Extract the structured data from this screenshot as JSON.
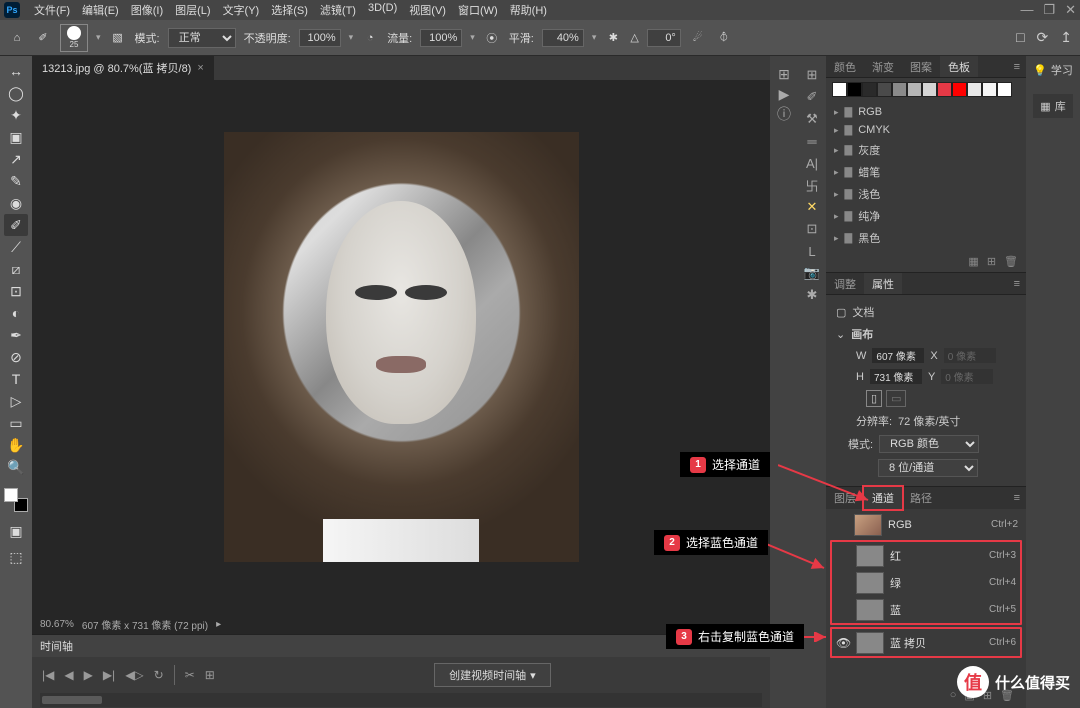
{
  "menu": {
    "items": [
      "文件(F)",
      "编辑(E)",
      "图像(I)",
      "图层(L)",
      "文字(Y)",
      "选择(S)",
      "滤镜(T)",
      "3D(D)",
      "视图(V)",
      "窗口(W)",
      "帮助(H)"
    ]
  },
  "win": {
    "min": "—",
    "restore": "❐",
    "close": "✕"
  },
  "options": {
    "home": "⌂",
    "brushSize": "25",
    "swatchTool": "▧",
    "modeLabel": "模式:",
    "mode": "正常",
    "opacityLabel": "不透明度:",
    "opacity": "100%",
    "flowLabel": "流量:",
    "flow": "100%",
    "smoothLabel": "平滑:",
    "smooth": "40%",
    "angleLabel": "△",
    "angle": "0°",
    "rightIcons": [
      "□",
      "⟳",
      "↥"
    ]
  },
  "tab": {
    "title": "13213.jpg @ 80.7%(蓝 拷贝/8)",
    "close": "×"
  },
  "status": {
    "zoom": "80.67%",
    "info": "607 像素 x 731 像素 (72 ppi)",
    "arrow": "▸"
  },
  "timeline": {
    "title": "时间轴",
    "menu": "≡",
    "controls": [
      "|◀",
      "◀",
      "▶",
      "▶|",
      "◀▷",
      "↻"
    ],
    "scissors": "✂",
    "grid": "⊞",
    "button": "创建视频时间轴",
    "dd": "▾"
  },
  "colorTabs": [
    "颜色",
    "渐变",
    "图案",
    "色板"
  ],
  "swatches": [
    "#ffffff",
    "#000000",
    "#2a2a2a",
    "#4a4a4a",
    "#8a8a8a",
    "#b5b5b5",
    "#d5d5d5",
    "#e63946",
    "#ff0000",
    "#e8e8e8",
    "#f5f5f5",
    "#ffffff"
  ],
  "colorFolders": [
    "RGB",
    "CMYK",
    "灰度",
    "蜡笔",
    "浅色",
    "纯净",
    "黑色"
  ],
  "folderFooter": [
    "▦",
    "⊞",
    "🗑"
  ],
  "adjTabs": [
    "调整",
    "属性"
  ],
  "props": {
    "docIcon": "▢",
    "docLabel": "文档",
    "canvasLabel": "画布",
    "collapse": "⌄",
    "W": "W",
    "wVal": "607 像素",
    "X": "X",
    "xVal": "0 像素",
    "H": "H",
    "hVal": "731 像素",
    "Y": "Y",
    "yVal": "0 像素",
    "orient": [
      "▯",
      "▭"
    ],
    "resLabel": "分辨率:",
    "resVal": "72 像素/英寸",
    "modeLabel": "模式:",
    "modeVal": "RGB 颜色",
    "depthVal": "8 位/通道"
  },
  "chTabs": [
    "图层",
    "通道",
    "路径"
  ],
  "channels": [
    {
      "eye": "",
      "name": "RGB",
      "key": "Ctrl+2",
      "color": true
    },
    {
      "eye": "",
      "name": "红",
      "key": "Ctrl+3"
    },
    {
      "eye": "",
      "name": "绿",
      "key": "Ctrl+4"
    },
    {
      "eye": "",
      "name": "蓝",
      "key": "Ctrl+5"
    },
    {
      "eye": "👁",
      "name": "蓝 拷贝",
      "key": "Ctrl+6"
    }
  ],
  "ann": [
    {
      "n": "1",
      "t": "选择通道"
    },
    {
      "n": "2",
      "t": "选择蓝色通道"
    },
    {
      "n": "3",
      "t": "右击复制蓝色通道"
    }
  ],
  "rightStrip": {
    "learn": "学习",
    "lib": "库"
  },
  "watermark": "什么值得买",
  "tools": [
    "↔",
    "◯",
    "✦",
    "▣",
    "↗",
    "✎",
    "◉",
    "✐",
    "⟋",
    "⧄",
    "⊡",
    "◐",
    "✒",
    "⊘",
    "T",
    "▷",
    "▭",
    "✋",
    "🔍"
  ],
  "mtools": [
    "⊞",
    "▶",
    "ⓘ"
  ],
  "stools": [
    "⊞",
    "✐",
    "⚒",
    "═",
    "A|",
    "卐",
    "✕",
    "⊡",
    "L",
    "📷",
    "✱"
  ]
}
